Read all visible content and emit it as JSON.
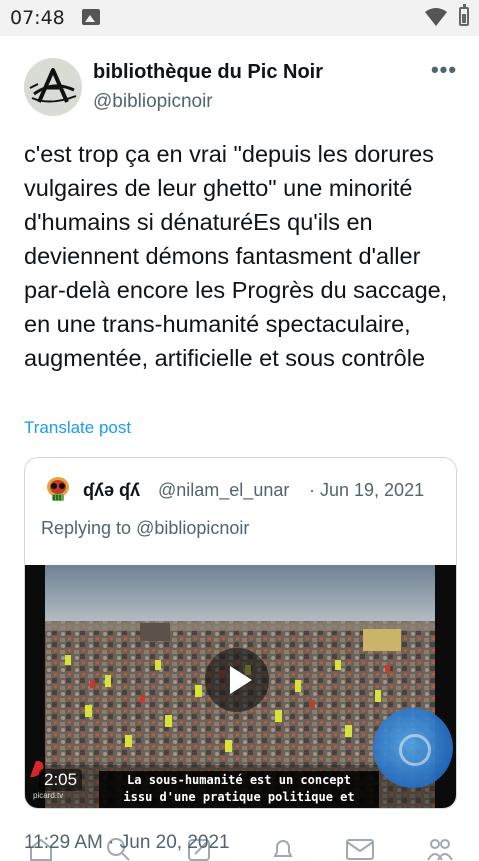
{
  "status_bar": {
    "time": "07:48"
  },
  "tweet": {
    "author": {
      "name": "bibliothèque du Pic Noir",
      "handle": "@bibliopicnoir"
    },
    "more_label": "•••",
    "text": "c'est trop ça en vrai \"depuis les dorures vulgaires de leur ghetto\" une minorité d'humains si dénaturéEs qu'ils en deviennent démons fantasment d'aller par-delà encore les Progrès du saccage, en une trans-humanité spectaculaire, augmentée, artificielle et sous contrôle",
    "translate_label": "Translate post",
    "timestamp": "11:29 AM · Jun 20, 2021"
  },
  "quoted": {
    "name": "ʠʎə ʠʎ",
    "handle": "@nilam_el_unar",
    "date": "· Jun 19, 2021",
    "reply_prefix": "Replying to ",
    "reply_mention": "@bibliopicnoir",
    "video": {
      "duration": "2:05",
      "subtitle_line1": "La sous-humanité est un concept",
      "subtitle_line2": "issu d'une pratique politique et sociale",
      "corner_logo": "picard.tv"
    }
  },
  "bottom_nav": {
    "items": [
      "home-icon",
      "search-icon",
      "compose-icon",
      "notifications-icon",
      "messages-icon",
      "communities-icon"
    ]
  },
  "colors": {
    "text_primary": "#0f1419",
    "text_secondary": "#536471",
    "link": "#1d9bf0",
    "border": "#cfd9de"
  }
}
